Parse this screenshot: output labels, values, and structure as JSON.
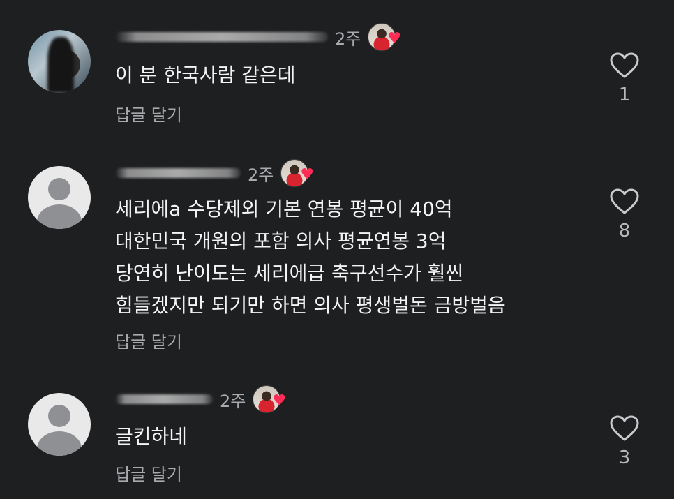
{
  "comments": [
    {
      "time": "2주",
      "text": "이 분 한국사람 같은데",
      "reply_label": "답글 달기",
      "likes": "1"
    },
    {
      "time": "2주",
      "text": "세리에a 수당제외 기본 연봉 평균이 40억\n대한민국 개원의 포함 의사 평균연봉 3억\n당연히 난이도는 세리에급 축구선수가 훨씬\n힘들겠지만 되기만 하면 의사 평생벌돈 금방벌음",
      "reply_label": "답글 달기",
      "likes": "8"
    },
    {
      "time": "2주",
      "text": "글킨하네",
      "reply_label": "답글 달기",
      "likes": "3"
    }
  ],
  "icons": {
    "like": "heart-outline-icon",
    "creator_like": "creator-heart-icon"
  },
  "colors": {
    "background": "#1e1f21",
    "text": "#f4f4f4",
    "secondary": "#a9aaae",
    "heart": "#ff2d55"
  }
}
